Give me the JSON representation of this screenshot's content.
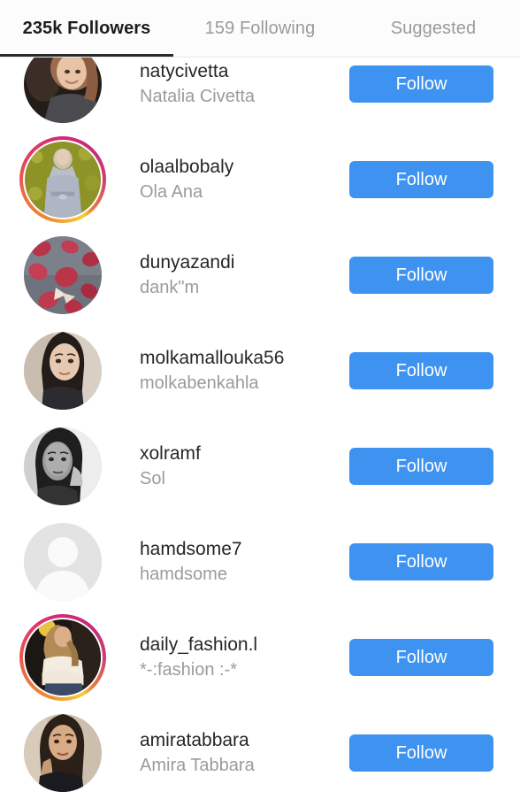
{
  "colors": {
    "follow_button": "#3e93f0",
    "active_tab_text": "#1c1c1c",
    "inactive_tab_text": "#9a9a9a",
    "username_text": "#262626",
    "fullname_text": "#9b9b9b",
    "active_tab_underline": "#2b2b2b",
    "page_background": "#ffffff",
    "header_background": "#fcfcfc",
    "story_ring_start": "#f9ce34",
    "story_ring_mid": "#e4405f",
    "story_ring_end": "#d62976"
  },
  "tabs": [
    {
      "label": "235k Followers",
      "active": true
    },
    {
      "label": "159 Following",
      "active": false
    },
    {
      "label": "Suggested",
      "active": false
    }
  ],
  "follow_label": "Follow",
  "users": [
    {
      "username": "natycivetta",
      "fullname": "Natalia Civetta",
      "has_story_ring": false,
      "avatar_type": "photo-portrait-warm",
      "follow_label": "Follow"
    },
    {
      "username": "olaalbobaly",
      "fullname": "Ola Ana",
      "has_story_ring": true,
      "avatar_type": "photo-field-green",
      "follow_label": "Follow"
    },
    {
      "username": "dunyazandi",
      "fullname": "dank\"m",
      "has_story_ring": false,
      "avatar_type": "photo-fruit-gray",
      "follow_label": "Follow"
    },
    {
      "username": "molkamallouka56",
      "fullname": "molkabenkahla",
      "has_story_ring": false,
      "avatar_type": "photo-portrait-pale",
      "follow_label": "Follow"
    },
    {
      "username": "xolramf",
      "fullname": "Sol",
      "has_story_ring": false,
      "avatar_type": "photo-portrait-bw",
      "follow_label": "Follow"
    },
    {
      "username": "hamdsome7",
      "fullname": "hamdsome",
      "has_story_ring": false,
      "avatar_type": "default-placeholder",
      "follow_label": "Follow"
    },
    {
      "username": "daily_fashion.l",
      "fullname": "*-:fashion :-*",
      "has_story_ring": true,
      "avatar_type": "photo-fashion-dark",
      "follow_label": "Follow"
    },
    {
      "username": "amiratabbara",
      "fullname": "Amira Tabbara",
      "has_story_ring": false,
      "avatar_type": "photo-portrait-dark",
      "follow_label": "Follow"
    }
  ]
}
